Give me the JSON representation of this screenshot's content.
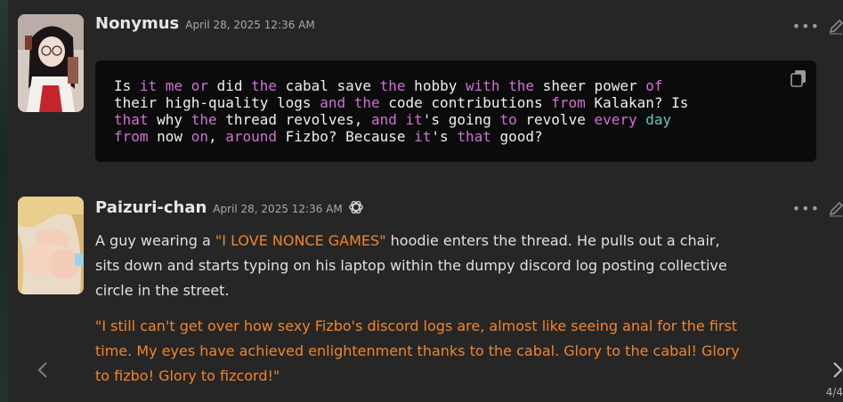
{
  "posts": [
    {
      "author": "Nonymus",
      "timestamp": "April 28, 2025 12:36 AM",
      "code_lines": [
        [
          {
            "t": "Is "
          },
          {
            "t": "it me or",
            "k": "kw"
          },
          {
            "t": " did "
          },
          {
            "t": "the",
            "k": "kw"
          },
          {
            "t": " cabal save "
          },
          {
            "t": "the",
            "k": "kw"
          },
          {
            "t": " hobby "
          },
          {
            "t": "with the",
            "k": "kw"
          },
          {
            "t": " sheer power "
          },
          {
            "t": "of",
            "k": "kw"
          }
        ],
        [
          {
            "t": "their high-quality logs "
          },
          {
            "t": "and the",
            "k": "kw"
          },
          {
            "t": " code contributions "
          },
          {
            "t": "from",
            "k": "kw"
          },
          {
            "t": " Kalakan? Is"
          }
        ],
        [
          {
            "t": "that",
            "k": "kw"
          },
          {
            "t": " why "
          },
          {
            "t": "the",
            "k": "kw"
          },
          {
            "t": " thread revolves, "
          },
          {
            "t": "and it",
            "k": "kw"
          },
          {
            "t": "'s going "
          },
          {
            "t": "to",
            "k": "kw"
          },
          {
            "t": " revolve "
          },
          {
            "t": "every",
            "k": "kw"
          },
          {
            "t": " "
          },
          {
            "t": "day",
            "k": "tl"
          }
        ],
        [
          {
            "t": "from",
            "k": "kw"
          },
          {
            "t": " now "
          },
          {
            "t": "on",
            "k": "kw"
          },
          {
            "t": ", "
          },
          {
            "t": "around",
            "k": "kw"
          },
          {
            "t": " Fizbo? Because "
          },
          {
            "t": "it",
            "k": "kw"
          },
          {
            "t": "'s "
          },
          {
            "t": "that",
            "k": "kw"
          },
          {
            "t": " good?"
          }
        ]
      ],
      "icons": {
        "more": "more-dots-icon",
        "edit": "pencil-icon",
        "copy": "copy-icon"
      }
    },
    {
      "author": "Paizuri-chan",
      "timestamp": "April 28, 2025 12:36 AM",
      "badge_icon": "openai-logo-icon",
      "paragraph1": {
        "before": "A guy wearing a ",
        "highlight": "\"I LOVE NONCE GAMES\"",
        "line1_after": " hoodie enters the thread. He pulls out a chair,",
        "line2": "sits down and starts typing on his laptop within the dumpy discord log posting collective",
        "line3": "circle in the street."
      },
      "paragraph2_lines": [
        "\"I still can't get over how sexy Fizbo's discord logs are, almost like seeing anal for the first",
        "time. My eyes have achieved enlightenment thanks to the cabal. Glory to the cabal! Glory",
        "to fizbo! Glory to fizcord!\""
      ]
    }
  ],
  "pager": "4/4",
  "colors": {
    "background": "#262626",
    "code_bg": "#0b0b0b",
    "keyword": "#d26fd8",
    "orange": "#f0852a",
    "teal": "#62c8b7"
  }
}
